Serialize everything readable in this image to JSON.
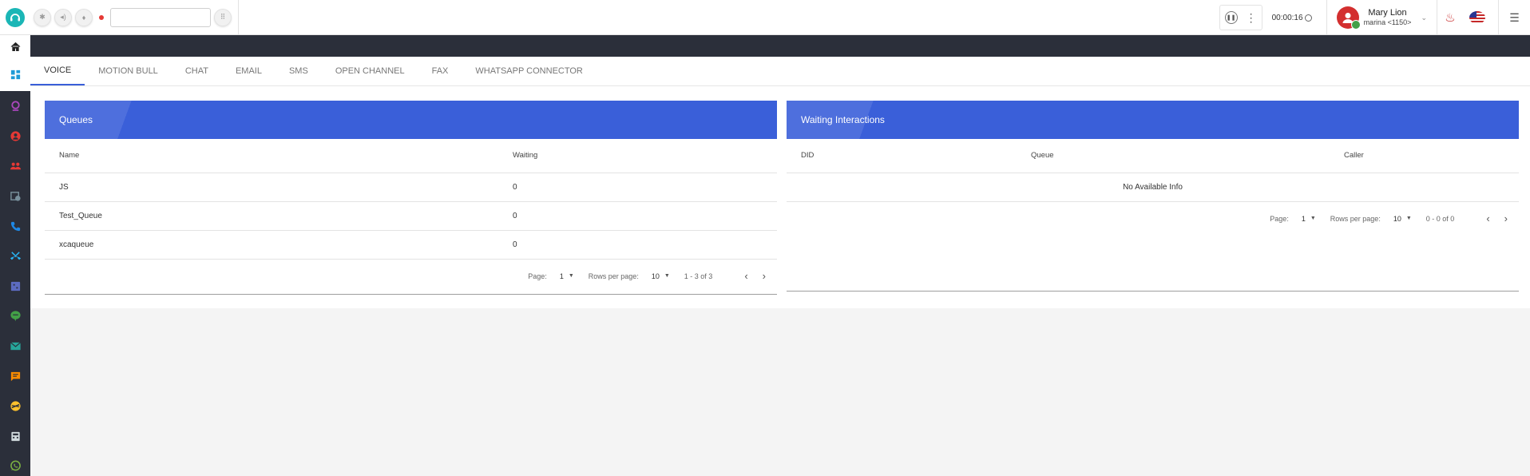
{
  "topbar": {
    "dial_placeholder": "",
    "timer": "00:00:16",
    "user_name": "Mary Lion",
    "user_ext": "marina <1150>"
  },
  "tabs": [
    {
      "label": "VOICE",
      "active": true
    },
    {
      "label": "MOTION BULL"
    },
    {
      "label": "CHAT"
    },
    {
      "label": "EMAIL"
    },
    {
      "label": "SMS"
    },
    {
      "label": "OPEN CHANNEL"
    },
    {
      "label": "FAX"
    },
    {
      "label": "WHATSAPP CONNECTOR"
    }
  ],
  "sidebar": {
    "icons": [
      "home-icon",
      "dashboard-icon",
      "monitor-icon",
      "contacts-icon",
      "groups-icon",
      "schedule-icon",
      "phone-icon",
      "call-missed-icon",
      "reports-icon",
      "chat-icon",
      "email-icon",
      "sms-icon",
      "openchannel-icon",
      "calculator-icon",
      "whatsapp-icon"
    ],
    "colors": {
      "accent": "#3a5fd9",
      "dark": "#2b2f3a"
    }
  },
  "queues": {
    "title": "Queues",
    "columns": [
      "Name",
      "Waiting"
    ],
    "rows": [
      {
        "name": "JS",
        "waiting": "0"
      },
      {
        "name": "Test_Queue",
        "waiting": "0"
      },
      {
        "name": "xcaqueue",
        "waiting": "0"
      }
    ],
    "pager": {
      "page_label": "Page:",
      "page": "1",
      "rows_label": "Rows per page:",
      "rows": "10",
      "range": "1 - 3 of 3"
    }
  },
  "waiting": {
    "title": "Waiting Interactions",
    "columns": [
      "DID",
      "Queue",
      "Caller"
    ],
    "empty": "No Available Info",
    "pager": {
      "page_label": "Page:",
      "page": "1",
      "rows_label": "Rows per page:",
      "rows": "10",
      "range": "0 - 0 of 0"
    }
  }
}
